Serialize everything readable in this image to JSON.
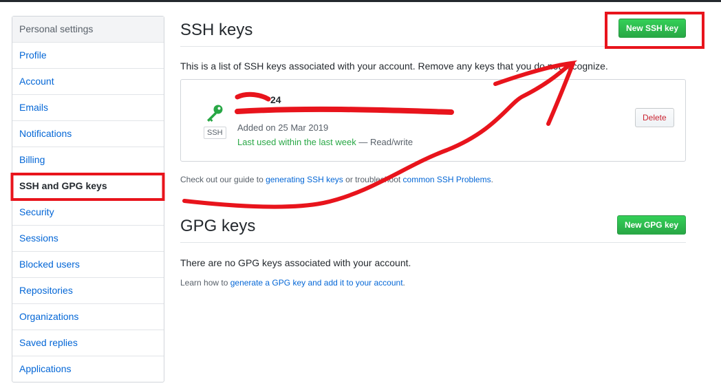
{
  "sidebar": {
    "header": "Personal settings",
    "items": [
      {
        "label": "Profile"
      },
      {
        "label": "Account"
      },
      {
        "label": "Emails"
      },
      {
        "label": "Notifications"
      },
      {
        "label": "Billing"
      },
      {
        "label": "SSH and GPG keys",
        "selected": true
      },
      {
        "label": "Security"
      },
      {
        "label": "Sessions"
      },
      {
        "label": "Blocked users"
      },
      {
        "label": "Repositories"
      },
      {
        "label": "Organizations"
      },
      {
        "label": "Saved replies"
      },
      {
        "label": "Applications"
      }
    ]
  },
  "ssh": {
    "title": "SSH keys",
    "new_button": "New SSH key",
    "description": "This is a list of SSH keys associated with your account. Remove any keys that you do not recognize.",
    "key": {
      "badge": "SSH",
      "title_suffix": "24",
      "added": "Added on 25 Mar 2019",
      "last_used": "Last used within the last week",
      "access": " — Read/write",
      "delete_button": "Delete"
    },
    "guide_prefix": "Check out our guide to ",
    "guide_link": "generating SSH keys",
    "guide_middle": " or troubleshoot ",
    "guide_link2": "common SSH Problems",
    "guide_suffix": "."
  },
  "gpg": {
    "title": "GPG keys",
    "new_button": "New GPG key",
    "empty": "There are no GPG keys associated with your account.",
    "learn_prefix": "Learn how to ",
    "learn_link": "generate a GPG key and add it to your account",
    "learn_suffix": "."
  },
  "colors": {
    "link": "#0366d6",
    "green": "#28a745",
    "annotation": "#e8141c"
  }
}
